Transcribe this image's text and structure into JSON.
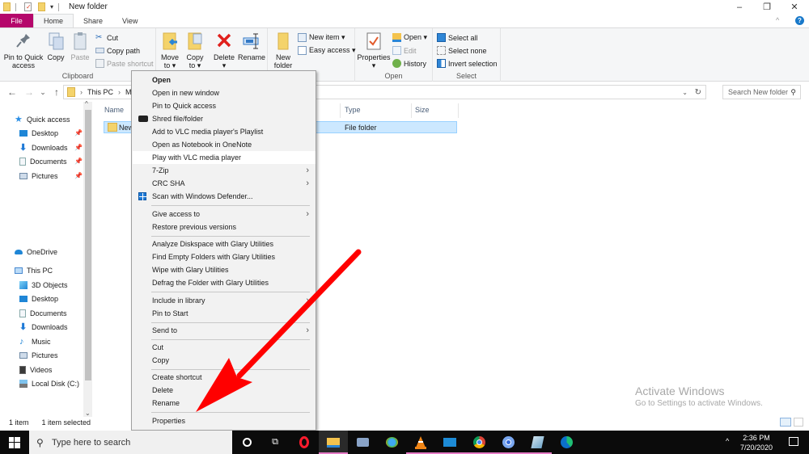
{
  "window": {
    "title": "New folder",
    "controls": {
      "minimize": "–",
      "restore": "❐",
      "close": "✕"
    }
  },
  "tabs": [
    {
      "label": "File"
    },
    {
      "label": "Home"
    },
    {
      "label": "Share"
    },
    {
      "label": "View"
    }
  ],
  "ribbon": {
    "clipboard": {
      "label": "Clipboard",
      "pin": "Pin to Quick access",
      "pin_l1": "Pin to Quick",
      "pin_l2": "access",
      "copy": "Copy",
      "paste": "Paste",
      "cut": "Cut",
      "copy_path": "Copy path",
      "paste_shortcut": "Paste shortcut"
    },
    "organize": {
      "move_to_l1": "Move",
      "move_to_l2": "to ▾",
      "copy_to_l1": "Copy",
      "copy_to_l2": "to ▾",
      "delete": "Delete",
      "delete_caret": "▾",
      "rename": "Rename"
    },
    "new": {
      "new_folder_l1": "New",
      "new_folder_l2": "folder",
      "new_item": "New item ▾",
      "easy_access": "Easy access ▾"
    },
    "open": {
      "label": "Open",
      "properties": "Properties",
      "properties_caret": "▾",
      "open": "Open ▾",
      "edit": "Edit",
      "history": "History"
    },
    "select": {
      "label": "Select",
      "select_all": "Select all",
      "select_none": "Select none",
      "invert": "Invert selection"
    }
  },
  "address": {
    "back": "←",
    "forward": "→",
    "recent": "⌄",
    "up": "↑",
    "path": [
      "This PC",
      "M..."
    ],
    "search_placeholder": "Search New folder"
  },
  "nav": {
    "quick_access": "Quick access",
    "quick_items": [
      "Desktop",
      "Downloads",
      "Documents",
      "Pictures"
    ],
    "onedrive": "OneDrive",
    "this_pc": "This PC",
    "pc_items": [
      "3D Objects",
      "Desktop",
      "Documents",
      "Downloads",
      "Music",
      "Pictures",
      "Videos",
      "Local Disk (C:)"
    ]
  },
  "columns": {
    "name": "Name",
    "type": "Type",
    "size": "Size"
  },
  "files": [
    {
      "name": "New",
      "type": "File folder",
      "size": ""
    }
  ],
  "status": {
    "count": "1 item",
    "selected": "1 item selected"
  },
  "watermark": {
    "title": "Activate Windows",
    "subtitle": "Go to Settings to activate Windows."
  },
  "context_menu": {
    "items": [
      {
        "label": "Open",
        "bold": true
      },
      {
        "label": "Open in new window"
      },
      {
        "label": "Pin to Quick access"
      },
      {
        "label": "Shred file/folder",
        "icon": "shredder-icon"
      },
      {
        "label": "Add to VLC media player's Playlist"
      },
      {
        "label": "Open as Notebook in OneNote"
      },
      {
        "label": "Play with VLC media player",
        "highlighted": true
      },
      {
        "label": "7-Zip",
        "submenu": true
      },
      {
        "label": "CRC SHA",
        "submenu": true
      },
      {
        "label": "Scan with Windows Defender...",
        "icon": "defender-icon"
      },
      {
        "label": "Give access to",
        "submenu": true
      },
      {
        "label": "Restore previous versions"
      },
      {
        "label": "Analyze Diskspace with Glary Utilities"
      },
      {
        "label": "Find Empty Folders with Glary Utilities"
      },
      {
        "label": "Wipe with Glary Utilities"
      },
      {
        "label": "Defrag the Folder with Glary Utilities"
      },
      {
        "label": "Include in library",
        "submenu": true
      },
      {
        "label": "Pin to Start"
      },
      {
        "label": "Send to",
        "submenu": true
      },
      {
        "label": "Cut"
      },
      {
        "label": "Copy"
      },
      {
        "label": "Create shortcut"
      },
      {
        "label": "Delete"
      },
      {
        "label": "Rename"
      },
      {
        "label": "Properties"
      }
    ]
  },
  "taskbar": {
    "search_placeholder": "Type here to search",
    "time": "2:36 PM",
    "date": "7/20/2020",
    "tray_chevron": "^"
  },
  "colors": {
    "file_tab": "#b5076b",
    "selection": "#cce8ff",
    "annotation_arrow": "#ff0000",
    "taskbar": "#0b0b0b"
  }
}
